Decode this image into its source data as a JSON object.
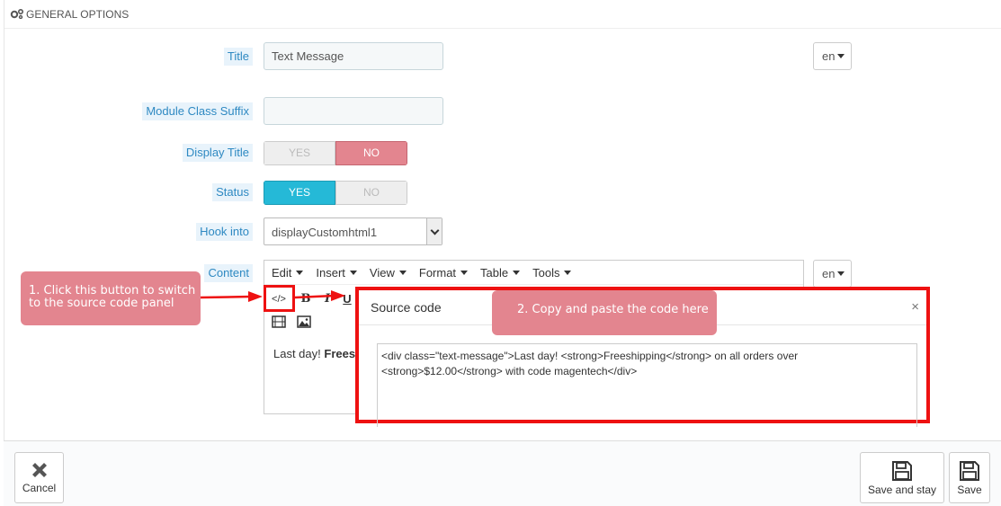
{
  "panel": {
    "heading": "GENERAL OPTIONS",
    "icon": "cogs-icon"
  },
  "fields": {
    "title": {
      "label": "Title",
      "value": "Text Message",
      "lang": "en"
    },
    "suffix": {
      "label": "Module Class Suffix",
      "value": ""
    },
    "display_title": {
      "label": "Display Title",
      "yes": "YES",
      "no": "NO",
      "selected": "NO"
    },
    "status": {
      "label": "Status",
      "yes": "YES",
      "no": "NO",
      "selected": "YES"
    },
    "hook": {
      "label": "Hook into",
      "value": "displayCustomhtml1"
    },
    "content": {
      "label": "Content",
      "lang": "en"
    }
  },
  "editor": {
    "menu": [
      "Edit",
      "Insert",
      "View",
      "Format",
      "Table",
      "Tools"
    ],
    "toolbar": {
      "source": "</>",
      "bold": "B",
      "italic": "I",
      "underline": "U"
    },
    "content_normal": "Last day! ",
    "content_bold": "Frees"
  },
  "source_modal": {
    "title": "Source code",
    "close": "×",
    "code_line1": "<div class=\"text-message\">Last day! <strong>Freeshipping</strong> on all orders over",
    "code_line2": "<strong>$12.00</strong> with code magentech</div>"
  },
  "callouts": {
    "step1_line1": "1. Click this button to switch",
    "step1_line2": "to the source code panel",
    "step2": "2. Copy and paste the code here"
  },
  "footer": {
    "cancel": "Cancel",
    "save_stay": "Save and stay",
    "save": "Save"
  },
  "colors": {
    "accent_blue": "#25b9d7",
    "label_blue": "#2e89c2",
    "no_pink": "#e3858f",
    "highlight_red": "#ee1111"
  }
}
